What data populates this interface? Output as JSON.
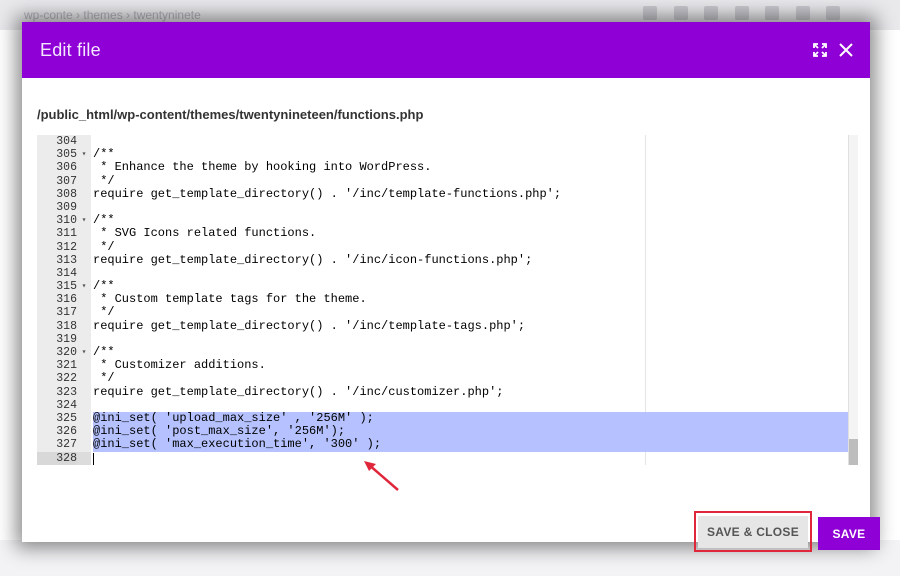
{
  "background": {
    "breadcrumb": "wp-conte  ›  themes  ›  twentyninete"
  },
  "modal": {
    "title": "Edit file",
    "icons": {
      "expand": "expand-icon",
      "close": "close-icon"
    },
    "file_path": "/public_html/wp-content/themes/twentynineteen/functions.php"
  },
  "editor": {
    "lines": [
      {
        "n": "304",
        "fold": false,
        "text": ""
      },
      {
        "n": "305",
        "fold": true,
        "text": "/**"
      },
      {
        "n": "306",
        "fold": false,
        "text": " * Enhance the theme by hooking into WordPress."
      },
      {
        "n": "307",
        "fold": false,
        "text": " */"
      },
      {
        "n": "308",
        "fold": false,
        "text": "require get_template_directory() . '/inc/template-functions.php';"
      },
      {
        "n": "309",
        "fold": false,
        "text": ""
      },
      {
        "n": "310",
        "fold": true,
        "text": "/**"
      },
      {
        "n": "311",
        "fold": false,
        "text": " * SVG Icons related functions."
      },
      {
        "n": "312",
        "fold": false,
        "text": " */"
      },
      {
        "n": "313",
        "fold": false,
        "text": "require get_template_directory() . '/inc/icon-functions.php';"
      },
      {
        "n": "314",
        "fold": false,
        "text": ""
      },
      {
        "n": "315",
        "fold": true,
        "text": "/**"
      },
      {
        "n": "316",
        "fold": false,
        "text": " * Custom template tags for the theme."
      },
      {
        "n": "317",
        "fold": false,
        "text": " */"
      },
      {
        "n": "318",
        "fold": false,
        "text": "require get_template_directory() . '/inc/template-tags.php';"
      },
      {
        "n": "319",
        "fold": false,
        "text": ""
      },
      {
        "n": "320",
        "fold": true,
        "text": "/**"
      },
      {
        "n": "321",
        "fold": false,
        "text": " * Customizer additions."
      },
      {
        "n": "322",
        "fold": false,
        "text": " */"
      },
      {
        "n": "323",
        "fold": false,
        "text": "require get_template_directory() . '/inc/customizer.php';"
      },
      {
        "n": "324",
        "fold": false,
        "text": ""
      },
      {
        "n": "325",
        "fold": false,
        "text": "@ini_set( 'upload_max_size' , '256M' );"
      },
      {
        "n": "326",
        "fold": false,
        "text": "@ini_set( 'post_max_size', '256M');"
      },
      {
        "n": "327",
        "fold": false,
        "text": "@ini_set( 'max_execution_time', '300' );"
      },
      {
        "n": "328",
        "fold": false,
        "text": ""
      }
    ],
    "selected_lines": [
      "325",
      "326",
      "327"
    ],
    "active_line": "328"
  },
  "buttons": {
    "save_close": "SAVE & CLOSE",
    "save": "SAVE"
  },
  "colors": {
    "accent": "#8f00d6",
    "highlight_box": "#e0263a",
    "selection": "#b5c2ff",
    "arrow": "#e0263a"
  }
}
